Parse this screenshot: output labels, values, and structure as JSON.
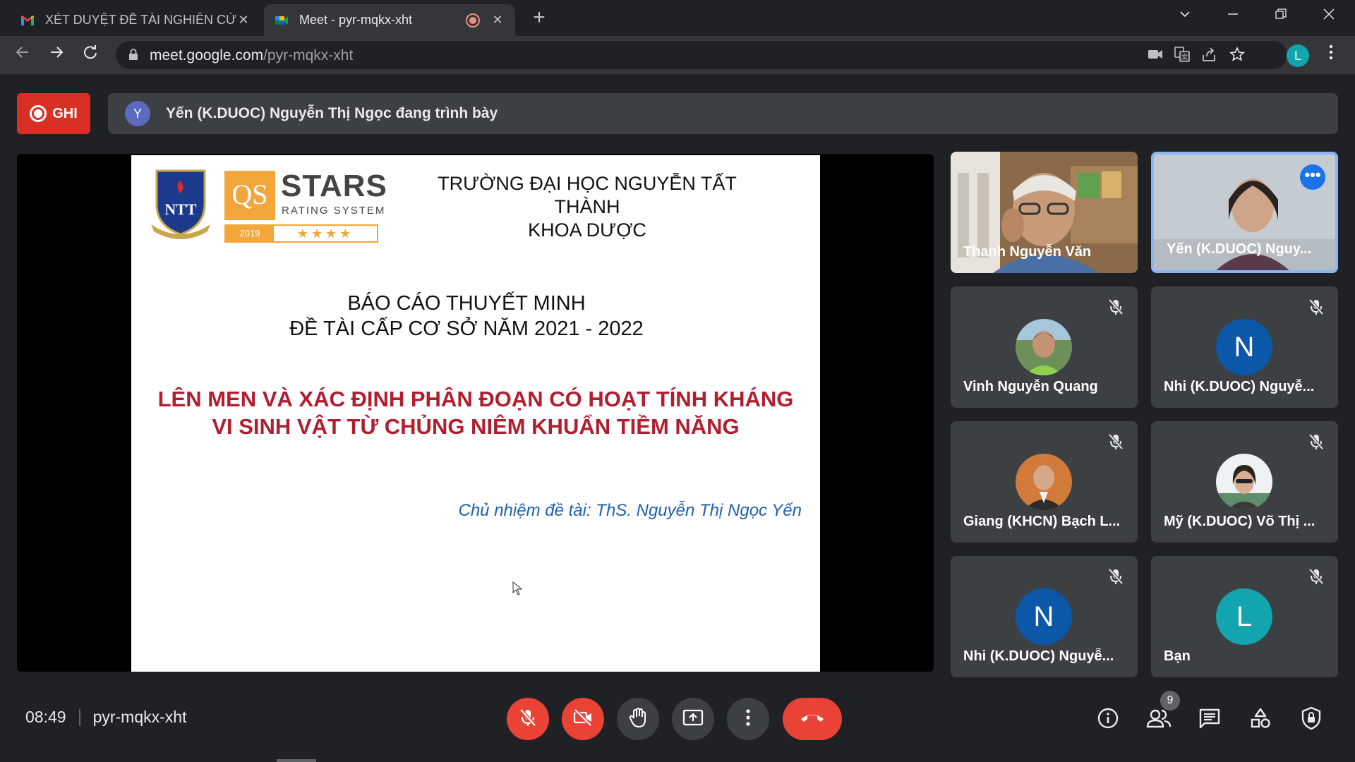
{
  "browser": {
    "tabs": [
      {
        "title": "XÉT DUYỆT ĐỀ TÀI NGHIÊN CỨU",
        "icon": "gmail-icon",
        "active": false
      },
      {
        "title": "Meet - pyr-mqkx-xht",
        "icon": "meet-icon",
        "active": true
      }
    ],
    "url_host": "meet.google.com",
    "url_path": "/pyr-mqkx-xht",
    "profile_initial": "L",
    "close_glyph": "✕",
    "new_tab_glyph": "+"
  },
  "meet": {
    "record_label": "GHI",
    "presenter_initial": "Y",
    "presenter_text": "Yến (K.DUOC) Nguyễn Thị Ngọc đang trình bày",
    "accent": "#d93025"
  },
  "slide": {
    "qs_logo": "QS",
    "qs_title": "STARS",
    "qs_subtitle": "RATING SYSTEM",
    "qs_year": "2019",
    "qs_stars": "★★★★",
    "school_line1": "TRƯỜNG ĐẠI HỌC NGUYỄN TẤT THÀNH",
    "school_line2": "KHOA DƯỢC",
    "report_line1": "BÁO CÁO THUYẾT MINH",
    "report_line2": "ĐỀ TÀI CẤP CƠ SỞ NĂM 2021 - 2022",
    "topic_line1": "LÊN MEN VÀ XÁC ĐỊNH PHÂN ĐOẠN CÓ HOẠT TÍNH KHÁNG",
    "topic_line2": "VI SINH VẬT TỪ CHỦNG NIÊM KHUẨN TIỀM NĂNG",
    "leader": "Chủ nhiệm đề tài: ThS. Nguyễn Thị Ngọc Yến"
  },
  "participants": [
    {
      "name": "Thanh Nguyễn Văn",
      "type": "video",
      "muted": false
    },
    {
      "name": "Yến (K.DUOC) Nguy...",
      "type": "video",
      "muted": false,
      "active": true,
      "more": "•••"
    },
    {
      "name": "Vinh Nguyễn Quang",
      "type": "photo",
      "muted": true
    },
    {
      "name": "Nhi (K.DUOC) Nguyễ...",
      "type": "initial",
      "initial": "N",
      "color": "#0b57a8",
      "muted": true
    },
    {
      "name": "Giang (KHCN) Bạch L...",
      "type": "photo",
      "muted": true
    },
    {
      "name": "Mỹ (K.DUOC) Võ Thị ...",
      "type": "photo",
      "muted": true
    },
    {
      "name": "Nhi (K.DUOC) Nguyễ...",
      "type": "initial",
      "initial": "N",
      "color": "#0b57a8",
      "muted": true
    },
    {
      "name": "Bạn",
      "type": "initial",
      "initial": "L",
      "color": "#12a4af",
      "muted": true
    }
  ],
  "footer": {
    "time": "08:49",
    "meeting_code": "pyr-mqkx-xht",
    "people_count": "9"
  }
}
